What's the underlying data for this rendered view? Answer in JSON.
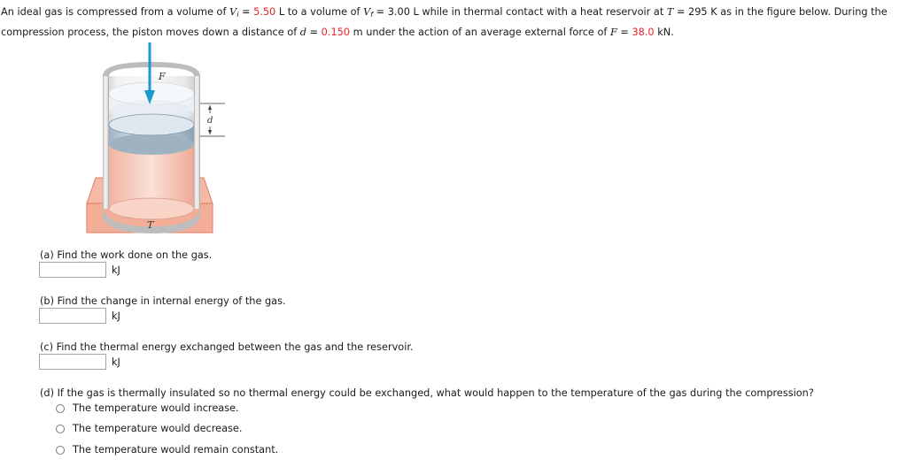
{
  "problem": {
    "line1": [
      {
        "t": "An ideal gas is compressed from a volume of "
      },
      {
        "t": "V",
        "var": true
      },
      {
        "t": "i",
        "sub": true
      },
      {
        "t": " = "
      },
      {
        "t": "5.50",
        "red": true
      },
      {
        "t": " L to a volume of "
      },
      {
        "t": "V",
        "var": true
      },
      {
        "t": "f",
        "sub": true
      },
      {
        "t": " = 3.00 L while in thermal contact with a heat reservoir at "
      },
      {
        "t": "T",
        "var": true
      },
      {
        "t": " = 295 K as in the figure below. During the"
      }
    ],
    "line2": [
      {
        "t": "compression process, the piston moves down a distance of "
      },
      {
        "t": "d",
        "var": true
      },
      {
        "t": " = "
      },
      {
        "t": "0.150",
        "red": true
      },
      {
        "t": " m under the action of an average external force of "
      },
      {
        "t": "F",
        "var": true
      },
      {
        "t": " = "
      },
      {
        "t": "38.0",
        "red": true
      },
      {
        "t": " kN."
      }
    ]
  },
  "figure": {
    "force_label": "F",
    "distance_label": "d",
    "reservoir_label": "T",
    "colors": {
      "arrow": "#1b9ad0",
      "gas": "#f5c4b4",
      "reservoir": "#f3b09c",
      "reservoir_edge": "#e07a62",
      "cylinder_wall": "#c9c9c9"
    }
  },
  "questions": [
    {
      "label": "(a) Find the work done on the gas.",
      "unit": "kJ",
      "value": ""
    },
    {
      "label": "(b) Find the change in internal energy of the gas.",
      "unit": "kJ",
      "value": ""
    },
    {
      "label": "(c) Find the thermal energy exchanged between the gas and the reservoir.",
      "unit": "kJ",
      "value": ""
    }
  ],
  "question_d": {
    "label": "(d) If the gas is thermally insulated so no thermal energy could be exchanged, what would happen to the temperature of the gas during the compression?",
    "options": [
      "The temperature would increase.",
      "The temperature would decrease.",
      "The temperature would remain constant."
    ]
  }
}
